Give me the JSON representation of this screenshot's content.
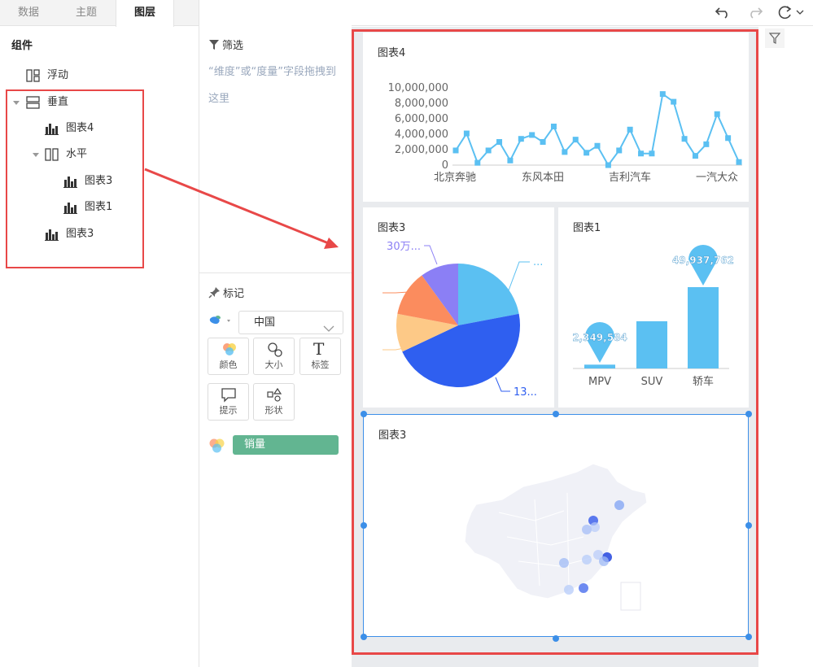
{
  "left_tabs": [
    "数据",
    "主题",
    "图层"
  ],
  "active_tab": "图层",
  "components_title": "组件",
  "tree": {
    "floating": "浮动",
    "vertical": "垂直",
    "chart4": "图表4",
    "horizontal": "水平",
    "chart3a": "图表3",
    "chart1": "图表1",
    "chart3b": "图表3"
  },
  "toolbar": {
    "component_label": "组件",
    "undo": "undo-icon",
    "redo": "redo-icon",
    "refresh": "refresh-icon"
  },
  "filter": {
    "title": "筛选",
    "hint": "“维度”或“度量”字段拖拽到这里"
  },
  "marks": {
    "title": "标记",
    "region": "中国",
    "buttons": [
      "颜色",
      "大小",
      "标签",
      "提示",
      "形状"
    ],
    "color_field": "销量"
  },
  "accent_colors": {
    "highlight": "#e84848",
    "line": "#5bc0f2",
    "pill": "#62b591",
    "selection": "#3c8fe8"
  },
  "chart_data": [
    {
      "title": "图表4",
      "type": "line",
      "categories": [
        "北京奔驰",
        "东风本田",
        "吉利汽车",
        "一汽大众"
      ],
      "y_ticks": [
        "10,000,000",
        "8,000,000",
        "6,000,000",
        "4,000,000",
        "2,000,000",
        "0"
      ],
      "ylim": [
        0,
        10000000
      ],
      "values": [
        1900000,
        4100000,
        300000,
        1900000,
        3000000,
        600000,
        3400000,
        3900000,
        3000000,
        5000000,
        1700000,
        3300000,
        1600000,
        2500000,
        0,
        1900000,
        4600000,
        1500000,
        1500000,
        9200000,
        8200000,
        3400000,
        1200000,
        2700000,
        6600000,
        3500000,
        400000
      ]
    },
    {
      "title": "图表3",
      "type": "pie",
      "slices": [
        {
          "value": 22,
          "color": "#5bc0f2"
        },
        {
          "value": 46,
          "color": "#2f5ff0"
        },
        {
          "value": 10,
          "color": "#fdc987"
        },
        {
          "value": 12,
          "color": "#fb8c5e"
        },
        {
          "value": 10,
          "color": "#8b7ff5"
        }
      ],
      "labels": [
        "30万...",
        "...",
        "13..."
      ]
    },
    {
      "title": "图表1",
      "type": "bar",
      "categories": [
        "MPV",
        "SUV",
        "轿车"
      ],
      "values": [
        2349584,
        29000000,
        49937762
      ],
      "data_labels": [
        "2,349,584",
        "49,937,762"
      ]
    },
    {
      "title": "图表3",
      "type": "map",
      "region": "中国"
    }
  ]
}
